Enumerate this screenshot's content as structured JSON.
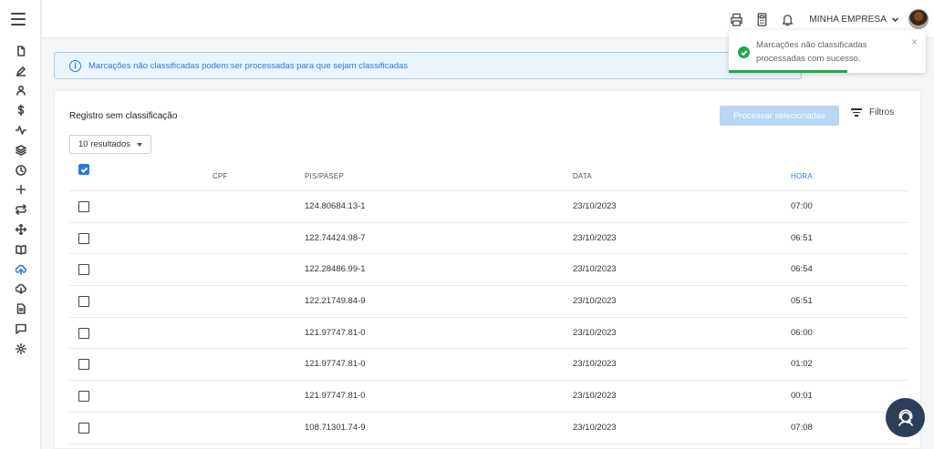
{
  "header": {
    "company_name": "MINHA EMPRESA",
    "icons": [
      "printer-icon",
      "calculator-icon",
      "bell-icon",
      "chevron-down-icon"
    ]
  },
  "sidebar": {
    "icons": [
      "file-icon",
      "pen-icon",
      "user-icon",
      "dollar-icon",
      "activity-icon",
      "layers-icon",
      "clock-icon",
      "plus-icon",
      "repeat-icon",
      "move-icon",
      "book-icon",
      "upload-cloud-icon",
      "download-cloud-icon",
      "document-icon",
      "chat-icon",
      "settings-icon"
    ],
    "active_icon": "upload-cloud-icon"
  },
  "banner": {
    "text": "Marcações não classificadas podem ser processadas para que sejam classificadas"
  },
  "toast": {
    "message": "Marcações não classificadas processadas com sucesso.",
    "close": "×",
    "progress": 0.6,
    "color": "#1fa84f"
  },
  "card": {
    "title": "Registro sem classificação",
    "process_button": "Processar selecionadas",
    "filters_label": "Filtros",
    "results_select": "10 resultados"
  },
  "table": {
    "columns": {
      "cpf": "CPF",
      "pis": "PIS/PASEP",
      "data": "DATA",
      "hora": "HORA"
    },
    "sorted_column": "hora",
    "rows": [
      {
        "cpf": "",
        "pis": "124.80684.13-1",
        "data": "23/10/2023",
        "hora": "07:00"
      },
      {
        "cpf": "",
        "pis": "122.74424.98-7",
        "data": "23/10/2023",
        "hora": "06:51"
      },
      {
        "cpf": "",
        "pis": "122.28486.99-1",
        "data": "23/10/2023",
        "hora": "06:54"
      },
      {
        "cpf": "",
        "pis": "122.21749.84-9",
        "data": "23/10/2023",
        "hora": "05:51"
      },
      {
        "cpf": "",
        "pis": "121.97747.81-0",
        "data": "23/10/2023",
        "hora": "06:00"
      },
      {
        "cpf": "",
        "pis": "121.97747.81-0",
        "data": "23/10/2023",
        "hora": "01:02"
      },
      {
        "cpf": "",
        "pis": "121.97747.81-0",
        "data": "23/10/2023",
        "hora": "00:01"
      },
      {
        "cpf": "",
        "pis": "108.71301.74-9",
        "data": "23/10/2023",
        "hora": "07:08"
      }
    ]
  },
  "colors": {
    "accent": "#2b7bd9",
    "success": "#1fa84f",
    "help_button": "#2c3e5a"
  }
}
